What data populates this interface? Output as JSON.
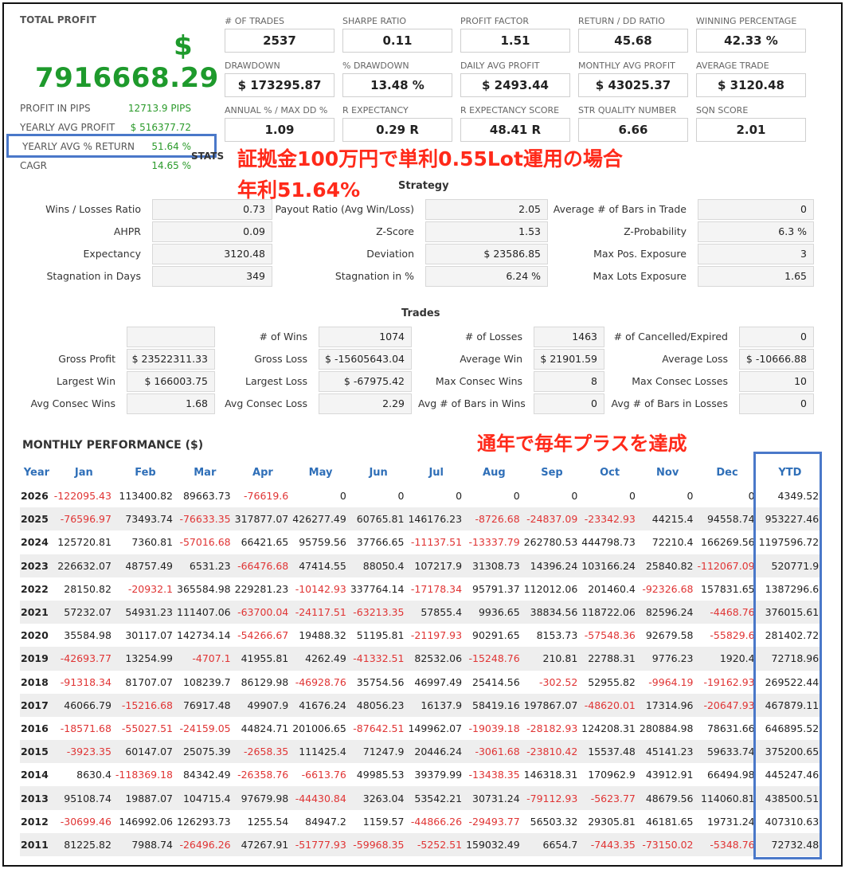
{
  "summary": {
    "title": "TOTAL PROFIT",
    "currency": "$",
    "value": "7916668.29",
    "rows": [
      {
        "label": "PROFIT IN PIPS",
        "value": "12713.9 PIPS"
      },
      {
        "label": "YEARLY AVG PROFIT",
        "value": "$ 516377.72"
      },
      {
        "label": "YEARLY AVG % RETURN",
        "value": "51.64 %"
      },
      {
        "label": "CAGR",
        "value": "14.65 %"
      }
    ],
    "stats_peek": "STATS"
  },
  "metrics": [
    {
      "label": "# OF TRADES",
      "value": "2537"
    },
    {
      "label": "SHARPE RATIO",
      "value": "0.11"
    },
    {
      "label": "PROFIT FACTOR",
      "value": "1.51"
    },
    {
      "label": "RETURN / DD RATIO",
      "value": "45.68"
    },
    {
      "label": "WINNING PERCENTAGE",
      "value": "42.33 %"
    },
    {
      "label": "DRAWDOWN",
      "value": "$ 173295.87"
    },
    {
      "label": "% DRAWDOWN",
      "value": "13.48 %"
    },
    {
      "label": "DAILY AVG PROFIT",
      "value": "$ 2493.44"
    },
    {
      "label": "MONTHLY AVG PROFIT",
      "value": "$ 43025.37"
    },
    {
      "label": "AVERAGE TRADE",
      "value": "$ 3120.48"
    },
    {
      "label": "ANNUAL % / MAX DD %",
      "value": "1.09"
    },
    {
      "label": "R EXPECTANCY",
      "value": "0.29 R"
    },
    {
      "label": "R EXPECTANCY SCORE",
      "value": "48.41 R"
    },
    {
      "label": "STR QUALITY NUMBER",
      "value": "6.66"
    },
    {
      "label": "SQN SCORE",
      "value": "2.01"
    }
  ],
  "annotations": {
    "line1": "証拠金100万円で単利0.55Lot運用の場合",
    "line2": "年利51.64%",
    "line3": "通年で毎年プラスを達成"
  },
  "strategy": {
    "title": "Strategy",
    "rows": [
      [
        [
          "Wins / Losses Ratio",
          "0.73"
        ],
        [
          "Payout Ratio (Avg Win/Loss)",
          "2.05"
        ],
        [
          "Average # of Bars in Trade",
          "0"
        ]
      ],
      [
        [
          "AHPR",
          "0.09"
        ],
        [
          "Z-Score",
          "1.53"
        ],
        [
          "Z-Probability",
          "6.3 %"
        ]
      ],
      [
        [
          "Expectancy",
          "3120.48"
        ],
        [
          "Deviation",
          "$ 23586.85"
        ],
        [
          "Max Pos. Exposure",
          "3"
        ]
      ],
      [
        [
          "Stagnation in Days",
          "349"
        ],
        [
          "Stagnation in %",
          "6.24 %"
        ],
        [
          "Max Lots Exposure",
          "1.65"
        ]
      ]
    ]
  },
  "trades": {
    "title": "Trades",
    "rows": [
      [
        [
          "",
          ""
        ],
        [
          "# of Wins",
          "1074"
        ],
        [
          "# of Losses",
          "1463"
        ],
        [
          "# of Cancelled/Expired",
          "0"
        ]
      ],
      [
        [
          "Gross Profit",
          "$ 23522311.33"
        ],
        [
          "Gross Loss",
          "$ -15605643.04"
        ],
        [
          "Average Win",
          "$ 21901.59"
        ],
        [
          "Average Loss",
          "$ -10666.88"
        ]
      ],
      [
        [
          "Largest Win",
          "$ 166003.75"
        ],
        [
          "Largest Loss",
          "$ -67975.42"
        ],
        [
          "Max Consec Wins",
          "8"
        ],
        [
          "Max Consec Losses",
          "10"
        ]
      ],
      [
        [
          "Avg Consec Wins",
          "1.68"
        ],
        [
          "Avg Consec Loss",
          "2.29"
        ],
        [
          "Avg # of Bars in Wins",
          "0"
        ],
        [
          "Avg # of Bars in Losses",
          "0"
        ]
      ]
    ]
  },
  "monthly": {
    "title": "MONTHLY PERFORMANCE ($)",
    "headers": [
      "Year",
      "Jan",
      "Feb",
      "Mar",
      "Apr",
      "May",
      "Jun",
      "Jul",
      "Aug",
      "Sep",
      "Oct",
      "Nov",
      "Dec",
      "YTD"
    ],
    "rows": [
      [
        "2026",
        "-122095.43",
        "113400.82",
        "89663.73",
        "-76619.6",
        "0",
        "0",
        "0",
        "0",
        "0",
        "0",
        "0",
        "0",
        "4349.52"
      ],
      [
        "2025",
        "-76596.97",
        "73493.74",
        "-76633.35",
        "317877.07",
        "426277.49",
        "60765.81",
        "146176.23",
        "-8726.68",
        "-24837.09",
        "-23342.93",
        "44215.4",
        "94558.74",
        "953227.46"
      ],
      [
        "2024",
        "125720.81",
        "7360.81",
        "-57016.68",
        "66421.65",
        "95759.56",
        "37766.65",
        "-11137.51",
        "-13337.79",
        "262780.53",
        "444798.73",
        "72210.4",
        "166269.56",
        "1197596.72"
      ],
      [
        "2023",
        "226632.07",
        "48757.49",
        "6531.23",
        "-66476.68",
        "47414.55",
        "88050.4",
        "107217.9",
        "31308.73",
        "14396.24",
        "103166.24",
        "25840.82",
        "-112067.09",
        "520771.9"
      ],
      [
        "2022",
        "28150.82",
        "-20932.1",
        "365584.98",
        "229281.23",
        "-10142.93",
        "337764.14",
        "-17178.34",
        "95791.37",
        "112012.06",
        "201460.4",
        "-92326.68",
        "157831.65",
        "1387296.6"
      ],
      [
        "2021",
        "57232.07",
        "54931.23",
        "111407.06",
        "-63700.04",
        "-24117.51",
        "-63213.35",
        "57855.4",
        "9936.65",
        "38834.56",
        "118722.06",
        "82596.24",
        "-4468.76",
        "376015.61"
      ],
      [
        "2020",
        "35584.98",
        "30117.07",
        "142734.14",
        "-54266.67",
        "19488.32",
        "51195.81",
        "-21197.93",
        "90291.65",
        "8153.73",
        "-57548.36",
        "92679.58",
        "-55829.6",
        "281402.72"
      ],
      [
        "2019",
        "-42693.77",
        "13254.99",
        "-4707.1",
        "41955.81",
        "4262.49",
        "-41332.51",
        "82532.06",
        "-15248.76",
        "210.81",
        "22788.31",
        "9776.23",
        "1920.4",
        "72718.96"
      ],
      [
        "2018",
        "-91318.34",
        "81707.07",
        "108239.7",
        "86129.98",
        "-46928.76",
        "35754.56",
        "46997.49",
        "25414.56",
        "-302.52",
        "52955.82",
        "-9964.19",
        "-19162.93",
        "269522.44"
      ],
      [
        "2017",
        "46066.79",
        "-15216.68",
        "76917.48",
        "49907.9",
        "41676.24",
        "48056.23",
        "16137.9",
        "58419.16",
        "197867.07",
        "-48620.01",
        "17314.96",
        "-20647.93",
        "467879.11"
      ],
      [
        "2016",
        "-18571.68",
        "-55027.51",
        "-24159.05",
        "44824.71",
        "201006.65",
        "-87642.51",
        "149962.07",
        "-19039.18",
        "-28182.93",
        "124208.31",
        "280884.98",
        "78631.66",
        "646895.52"
      ],
      [
        "2015",
        "-3923.35",
        "60147.07",
        "25075.39",
        "-2658.35",
        "111425.4",
        "71247.9",
        "20446.24",
        "-3061.68",
        "-23810.42",
        "15537.48",
        "45141.23",
        "59633.74",
        "375200.65"
      ],
      [
        "2014",
        "8630.4",
        "-118369.18",
        "84342.49",
        "-26358.76",
        "-6613.76",
        "49985.53",
        "39379.99",
        "-13438.35",
        "146318.31",
        "170962.9",
        "43912.91",
        "66494.98",
        "445247.46"
      ],
      [
        "2013",
        "95108.74",
        "19887.07",
        "104715.4",
        "97679.98",
        "-44430.84",
        "3263.04",
        "53542.21",
        "30731.24",
        "-79112.93",
        "-5623.77",
        "48679.56",
        "114060.81",
        "438500.51"
      ],
      [
        "2012",
        "-30699.46",
        "146992.06",
        "126293.73",
        "1255.54",
        "84947.2",
        "1159.57",
        "-44866.26",
        "-29493.77",
        "56503.32",
        "29305.81",
        "46181.65",
        "19731.24",
        "407310.63"
      ],
      [
        "2011",
        "81225.82",
        "7988.74",
        "-26496.26",
        "47267.91",
        "-51777.93",
        "-59968.35",
        "-5252.51",
        "159032.49",
        "6654.7",
        "-7443.35",
        "-73150.02",
        "-5348.76",
        "72732.48"
      ]
    ]
  }
}
